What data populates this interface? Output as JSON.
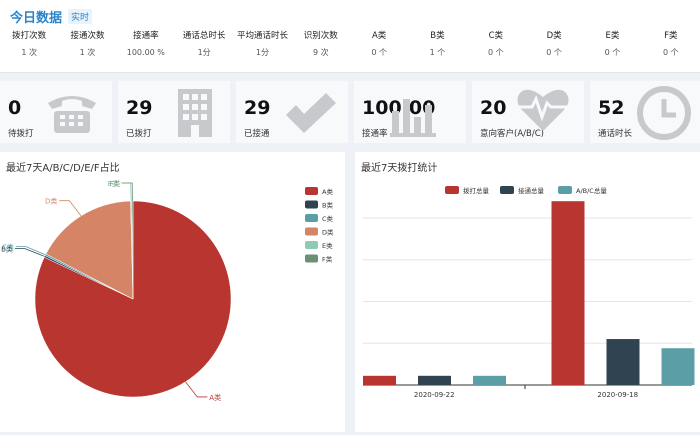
{
  "header": {
    "title": "今日数据",
    "badge": "实时"
  },
  "metrics": [
    {
      "label": "拨打次数",
      "value": "1 次"
    },
    {
      "label": "接通次数",
      "value": "1 次"
    },
    {
      "label": "接通率",
      "value": "100.00 %"
    },
    {
      "label": "通话总时长",
      "value": "1分"
    },
    {
      "label": "平均通话时长",
      "value": "1分"
    },
    {
      "label": "识别次数",
      "value": "9 次"
    },
    {
      "label": "A类",
      "value": "0 个"
    },
    {
      "label": "B类",
      "value": "1 个"
    },
    {
      "label": "C类",
      "value": "0 个"
    },
    {
      "label": "D类",
      "value": "0 个"
    },
    {
      "label": "E类",
      "value": "0 个"
    },
    {
      "label": "F类",
      "value": "0 个"
    }
  ],
  "cards": [
    {
      "value": "0",
      "label": "待拨打",
      "icon": "phone-icon"
    },
    {
      "value": "29",
      "label": "已拨打",
      "icon": "building-icon"
    },
    {
      "value": "29",
      "label": "已接通",
      "icon": "check-icon"
    },
    {
      "value": "100.00",
      "label": "接通率",
      "icon": "bar-chart-icon"
    },
    {
      "value": "20",
      "label": "意向客户(A/B/C)",
      "icon": "heartbeat-icon"
    },
    {
      "value": "52",
      "label": "通话时长",
      "icon": "clock-icon"
    }
  ],
  "left_panel": {
    "title": "最近7天A/B/C/D/E/F占比"
  },
  "right_panel": {
    "title": "最近7天拨打统计"
  },
  "colors": {
    "accent": "#2a84cc",
    "a": "#b83530",
    "b": "#2f4350",
    "c": "#5c9ea6",
    "d": "#d58466",
    "e": "#8fcbb2",
    "f": "#6b8f72"
  },
  "chart_data": [
    {
      "type": "pie",
      "title": "最近7天A/B/C/D/E/F占比",
      "labels": [
        "A类",
        "B类",
        "C类",
        "D类",
        "E类",
        "F类"
      ],
      "values": [
        82,
        0.3,
        0.3,
        17,
        0.2,
        0.2
      ],
      "legend": "right"
    },
    {
      "type": "bar",
      "title": "最近7天拨打统计",
      "categories": [
        "2020-09-22",
        "2020-09-18"
      ],
      "series": [
        {
          "name": "拨打总量",
          "values": [
            2,
            40
          ]
        },
        {
          "name": "接通总量",
          "values": [
            2,
            10
          ]
        },
        {
          "name": "A/B/C总量",
          "values": [
            2,
            8
          ]
        }
      ],
      "ylim": [
        0,
        42
      ],
      "legend": "top"
    }
  ]
}
